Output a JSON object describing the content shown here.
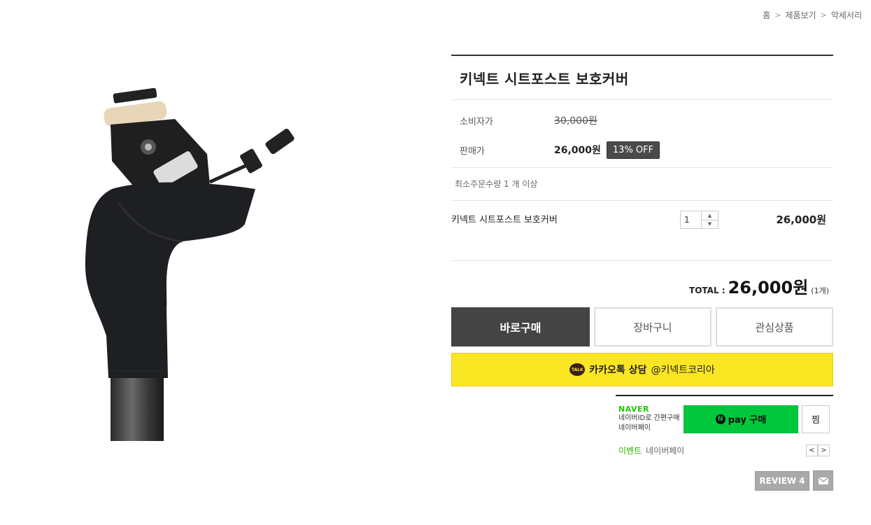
{
  "breadcrumb": {
    "home": "홈",
    "sep1": ">",
    "category": "제품보기",
    "sep2": ">",
    "current": "악세서리"
  },
  "product": {
    "title": "키넥트 시트포스트 보호커버",
    "consumer_price_label": "소비자가",
    "consumer_price": "30,000원",
    "sale_price_label": "판매가",
    "sale_price": "26,000원",
    "discount_badge": "13% OFF",
    "min_order": "최소주문수량 1 개 이상"
  },
  "option": {
    "name": "키넥트 시트포스트 보호커버",
    "quantity": "1",
    "qty_up": "▲",
    "qty_down": "▼",
    "price": "26,000원"
  },
  "total": {
    "label": "TOTAL :",
    "price": "26,000원",
    "count": "(1개)"
  },
  "buttons": {
    "buy": "바로구매",
    "cart": "장바구니",
    "wish": "관심상품"
  },
  "kakao": {
    "icon_text": "TALK",
    "strong": "카카오톡 상담",
    "handle": "@키넥트코리아"
  },
  "naver": {
    "logo": "NAVER",
    "sub1": "네이버ID로 간편구매",
    "sub2": "네이버페이",
    "pay_n": "N",
    "pay_label": "pay 구매",
    "zzim": "찜",
    "event_label": "이벤트",
    "event_text": "네이버페이",
    "prev": "<",
    "next": ">"
  },
  "review": {
    "label": "REVIEW",
    "count": "4"
  },
  "colors": {
    "kakao": "#fae622",
    "npay": "#00c73c",
    "naver_green": "#1ec800",
    "dark_button": "#444444"
  }
}
